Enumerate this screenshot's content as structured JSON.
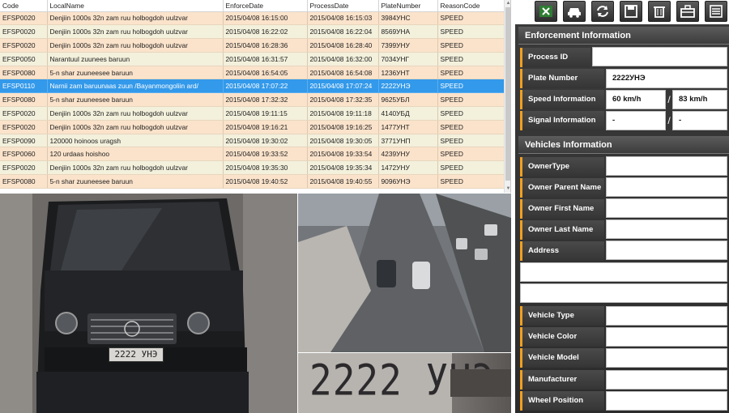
{
  "grid": {
    "columns": [
      "Code",
      "LocalName",
      "EnforceDate",
      "ProcessDate",
      "PlateNumber",
      "ReasonCode"
    ],
    "rows": [
      [
        "EFSP0020",
        "Denjiin 1000s 32n zam ruu holbogdoh uulzvar",
        "2015/04/08 16:15:00",
        "2015/04/08 16:15:03",
        "3984УНС",
        "SPEED"
      ],
      [
        "EFSP0020",
        "Denjiin 1000s 32n zam ruu holbogdoh uulzvar",
        "2015/04/08 16:22:02",
        "2015/04/08 16:22:04",
        "8569УНА",
        "SPEED"
      ],
      [
        "EFSP0020",
        "Denjiin 1000s 32n zam ruu holbogdoh uulzvar",
        "2015/04/08 16:28:36",
        "2015/04/08 16:28:40",
        "7399УНУ",
        "SPEED"
      ],
      [
        "EFSP0050",
        "Narantuul zuunees baruun",
        "2015/04/08 16:31:57",
        "2015/04/08 16:32:00",
        "7034УНГ",
        "SPEED"
      ],
      [
        "EFSP0080",
        "5-n shar zuuneesee baruun",
        "2015/04/08 16:54:05",
        "2015/04/08 16:54:08",
        "1236УНТ",
        "SPEED"
      ],
      [
        "EFSP0110",
        "Narnii zam baruunaas zuun /Bayanmongoliin ard/",
        "2015/04/08 17:07:22",
        "2015/04/08 17:07:24",
        "2222УНЭ",
        "SPEED"
      ],
      [
        "EFSP0080",
        "5-n shar zuuneesee baruun",
        "2015/04/08 17:32:32",
        "2015/04/08 17:32:35",
        "9625УБЛ",
        "SPEED"
      ],
      [
        "EFSP0020",
        "Denjiin 1000s 32n zam ruu holbogdoh uulzvar",
        "2015/04/08 19:11:15",
        "2015/04/08 19:11:18",
        "4140УБД",
        "SPEED"
      ],
      [
        "EFSP0020",
        "Denjiin 1000s 32n zam ruu holbogdoh uulzvar",
        "2015/04/08 19:16:21",
        "2015/04/08 19:16:25",
        "1477УНТ",
        "SPEED"
      ],
      [
        "EFSP0090",
        "120000 hoinoos uragsh",
        "2015/04/08 19:30:02",
        "2015/04/08 19:30:05",
        "3771УНП",
        "SPEED"
      ],
      [
        "EFSP0060",
        "120 urdaas hoishoo",
        "2015/04/08 19:33:52",
        "2015/04/08 19:33:54",
        "4239УНУ",
        "SPEED"
      ],
      [
        "EFSP0020",
        "Denjiin 1000s 32n zam ruu holbogdoh uulzvar",
        "2015/04/08 19:35:30",
        "2015/04/08 19:35:34",
        "1472УНУ",
        "SPEED"
      ],
      [
        "EFSP0080",
        "5-n shar zuuneesee baruun",
        "2015/04/08 19:40:52",
        "2015/04/08 19:40:55",
        "9096УНЭ",
        "SPEED"
      ]
    ],
    "selected_index": 5
  },
  "images": {
    "plate_crop_text": "2222 УНЭ",
    "car_plate_text": "2222 УНЭ"
  },
  "toolbar": {
    "buttons": [
      "excel-icon",
      "car-icon",
      "refresh-icon",
      "save-icon",
      "delete-icon",
      "toolbox-icon",
      "list-icon"
    ]
  },
  "enforcement": {
    "title": "Enforcement Information",
    "process_id_label": "Process ID",
    "process_id_value": "",
    "plate_label": "Plate Number",
    "plate_value": "2222УНЭ",
    "speed_label": "Speed Information",
    "speed_limit": "60 km/h",
    "speed_measured": "83 km/h",
    "signal_label": "Signal Information",
    "signal_a": "-",
    "signal_b": "-",
    "separator": "/"
  },
  "vehicles": {
    "title": "Vehicles Information",
    "owner_type_label": "OwnerType",
    "owner_parent_label": "Owner Parent Name",
    "owner_first_label": "Owner First Name",
    "owner_last_label": "Owner Last Name",
    "address_label": "Address",
    "vehicle_type_label": "Vehicle Type",
    "vehicle_color_label": "Vehicle Color",
    "vehicle_model_label": "Vehicle Model",
    "manufacturer_label": "Manufacturer",
    "wheel_position_label": "Wheel Position"
  },
  "colors": {
    "row_odd": "#fbe3cb",
    "row_even": "#f3f0dc",
    "row_selected": "#3399ea",
    "label_accent": "#f0a020",
    "panel_bg": "#333333"
  }
}
